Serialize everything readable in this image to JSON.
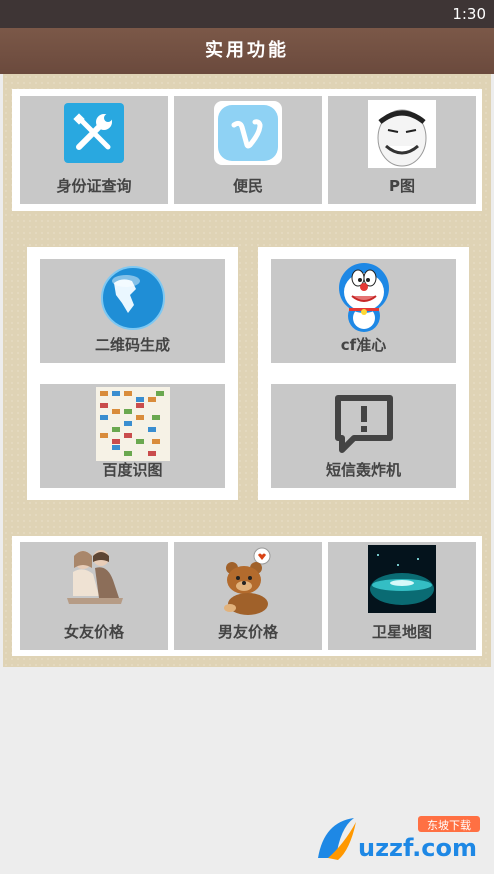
{
  "status": {
    "time": "1:30"
  },
  "header": {
    "title": "实用功能"
  },
  "group1": [
    {
      "label": "身份证查询",
      "icon": "tools-icon"
    },
    {
      "label": "便民",
      "icon": "vimeo-icon"
    },
    {
      "label": "P图",
      "icon": "meme-face-icon"
    }
  ],
  "group2": [
    {
      "label": "二维码生成",
      "icon": "globe-icon"
    },
    {
      "label": "cf准心",
      "icon": "doraemon-icon"
    },
    {
      "label": "百度识图",
      "icon": "image-grid-icon"
    },
    {
      "label": "短信轰炸机",
      "icon": "alert-chat-icon"
    }
  ],
  "group3": [
    {
      "label": "女友价格",
      "icon": "couple-icon"
    },
    {
      "label": "男友价格",
      "icon": "bear-icon"
    },
    {
      "label": "卫星地图",
      "icon": "earth-icon"
    }
  ],
  "watermark": {
    "brand": "uzzf.com",
    "tag": "东坡下载"
  }
}
